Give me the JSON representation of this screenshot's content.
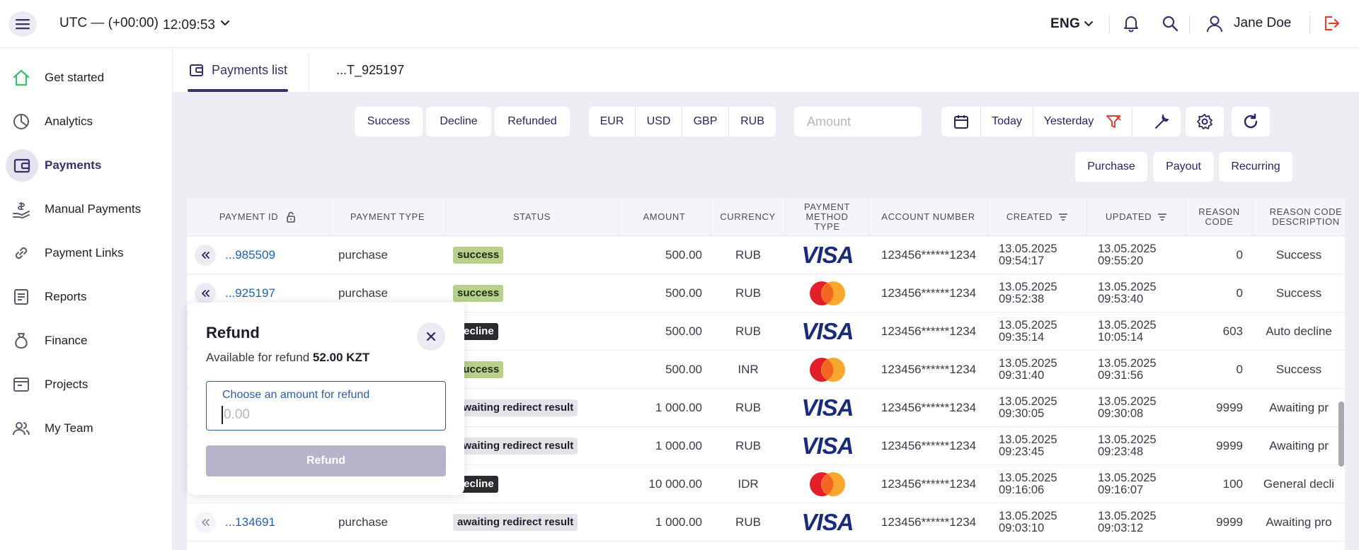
{
  "header": {
    "timezone": "UTC — (+00:00)",
    "time": "12:09:53",
    "language": "ENG",
    "user_name": "Jane Doe"
  },
  "sidebar": {
    "items": [
      {
        "label": "Get started",
        "icon": "home-icon"
      },
      {
        "label": "Analytics",
        "icon": "pie-chart-icon"
      },
      {
        "label": "Payments",
        "icon": "wallet-icon",
        "active": true
      },
      {
        "label": "Manual Payments",
        "icon": "hand-money-icon"
      },
      {
        "label": "Payment Links",
        "icon": "link-icon"
      },
      {
        "label": "Reports",
        "icon": "document-icon"
      },
      {
        "label": "Finance",
        "icon": "money-bag-icon"
      },
      {
        "label": "Projects",
        "icon": "folder-icon"
      },
      {
        "label": "My Team",
        "icon": "team-icon"
      }
    ]
  },
  "tabs": [
    {
      "label": "Payments list",
      "active": true
    },
    {
      "label": "...T_925197",
      "active": false
    }
  ],
  "filters": {
    "status": [
      "Success",
      "Decline",
      "Refunded"
    ],
    "currency": [
      "EUR",
      "USD",
      "GBP",
      "RUB"
    ],
    "amount_placeholder": "Amount",
    "date": [
      "Today",
      "Yesterday"
    ],
    "types": [
      "Purchase",
      "Payout",
      "Recurring"
    ]
  },
  "table": {
    "headers": {
      "payment_id": "PAYMENT ID",
      "payment_type": "PAYMENT TYPE",
      "status": "STATUS",
      "amount": "AMOUNT",
      "currency": "CURRENCY",
      "method": "PAYMENT METHOD TYPE",
      "account": "ACCOUNT NUMBER",
      "created": "CREATED",
      "updated": "UPDATED",
      "reason_code": "REASON CODE",
      "reason_desc": "REASON CODE DESCRIPTION"
    },
    "rows": [
      {
        "id": "...985509",
        "type": "purchase",
        "status": "success",
        "amount": "500.00",
        "currency": "RUB",
        "method": "visa",
        "account": "123456******1234",
        "created_date": "13.05.2025",
        "created_time": "09:54:17",
        "updated_date": "13.05.2025",
        "updated_time": "09:55:20",
        "reason_code": "0",
        "reason_desc": "Success"
      },
      {
        "id": "...925197",
        "type": "purchase",
        "status": "success",
        "amount": "500.00",
        "currency": "RUB",
        "method": "mastercard",
        "account": "123456******1234",
        "created_date": "13.05.2025",
        "created_time": "09:52:38",
        "updated_date": "13.05.2025",
        "updated_time": "09:53:40",
        "reason_code": "0",
        "reason_desc": "Success"
      },
      {
        "id": "",
        "type": "",
        "status": "decline",
        "amount": "500.00",
        "currency": "RUB",
        "method": "visa",
        "account": "123456******1234",
        "created_date": "13.05.2025",
        "created_time": "09:35:14",
        "updated_date": "13.05.2025",
        "updated_time": "10:05:14",
        "reason_code": "603",
        "reason_desc": "Auto decline"
      },
      {
        "id": "",
        "type": "",
        "status": "success",
        "amount": "500.00",
        "currency": "INR",
        "method": "mastercard",
        "account": "123456******1234",
        "created_date": "13.05.2025",
        "created_time": "09:31:40",
        "updated_date": "13.05.2025",
        "updated_time": "09:31:56",
        "reason_code": "0",
        "reason_desc": "Success"
      },
      {
        "id": "",
        "type": "",
        "status": "awaiting redirect result",
        "amount": "1 000.00",
        "currency": "RUB",
        "method": "visa",
        "account": "123456******1234",
        "created_date": "13.05.2025",
        "created_time": "09:30:05",
        "updated_date": "13.05.2025",
        "updated_time": "09:30:08",
        "reason_code": "9999",
        "reason_desc": "Awaiting pr"
      },
      {
        "id": "",
        "type": "",
        "status": "awaiting redirect result",
        "amount": "1 000.00",
        "currency": "RUB",
        "method": "visa",
        "account": "123456******1234",
        "created_date": "13.05.2025",
        "created_time": "09:23:45",
        "updated_date": "13.05.2025",
        "updated_time": "09:23:48",
        "reason_code": "9999",
        "reason_desc": "Awaiting pr"
      },
      {
        "id": "",
        "type": "",
        "status": "decline",
        "amount": "10 000.00",
        "currency": "IDR",
        "method": "mastercard",
        "account": "123456******1234",
        "created_date": "13.05.2025",
        "created_time": "09:16:06",
        "updated_date": "13.05.2025",
        "updated_time": "09:16:07",
        "reason_code": "100",
        "reason_desc": "General decli"
      },
      {
        "id": "...134691",
        "type": "purchase",
        "status": "awaiting redirect result",
        "amount": "1 000.00",
        "currency": "RUB",
        "method": "visa",
        "account": "123456******1234",
        "created_date": "13.05.2025",
        "created_time": "09:03:10",
        "updated_date": "13.05.2025",
        "updated_time": "09:03:12",
        "reason_code": "9999",
        "reason_desc": "Awaiting pro"
      }
    ]
  },
  "refund_popup": {
    "title": "Refund",
    "available_label": "Available for refund",
    "available_amount": "52.00 KZT",
    "field_label": "Choose an amount for refund",
    "placeholder": "0.00",
    "button_label": "Refund"
  },
  "colors": {
    "brand": "#3c2d6b",
    "link": "#1f63b5",
    "success": "#b9cf8c",
    "decline": "#2c2c30",
    "logout": "#d9433a",
    "filter_accent": "#d9433a",
    "home": "#35c46a"
  }
}
